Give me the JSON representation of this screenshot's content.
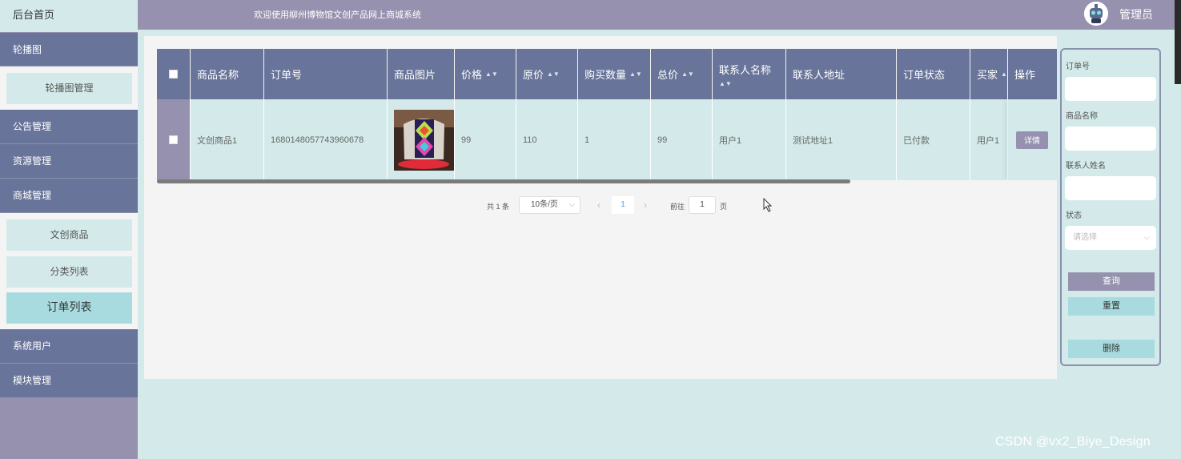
{
  "sidebar": {
    "home": "后台首页",
    "items": [
      "轮播图",
      "公告管理",
      "资源管理",
      "商城管理",
      "系统用户",
      "模块管理"
    ],
    "sub_carousel": [
      "轮播图管理"
    ],
    "sub_mall": [
      "文创商品",
      "分类列表",
      "订单列表"
    ],
    "active": "订单列表"
  },
  "header": {
    "welcome": "欢迎使用柳州博物馆文创产品网上商城系统",
    "user": "管理员"
  },
  "table": {
    "columns": [
      "商品名称",
      "订单号",
      "商品图片",
      "价格",
      "原价",
      "购买数量",
      "总价",
      "联系人名称",
      "联系人地址",
      "订单状态",
      "买家",
      "操作"
    ],
    "rows": [
      {
        "name": "文创商品1",
        "order_no": "1680148057743960678",
        "price": "99",
        "orig_price": "110",
        "qty": "1",
        "total": "99",
        "contact": "用户1",
        "address": "测试地址1",
        "status": "已付款",
        "buyer": "用户1",
        "action": "详情"
      }
    ]
  },
  "pagination": {
    "total": "共 1 条",
    "page_size": "10条/页",
    "current": "1",
    "goto_label": "前往",
    "goto_value": "1",
    "page_unit": "页"
  },
  "search": {
    "order_no_label": "订单号",
    "product_label": "商品名称",
    "contact_label": "联系人姓名",
    "status_label": "状态",
    "status_placeholder": "请选择",
    "query": "查询",
    "reset": "重置",
    "delete": "删除"
  },
  "watermark": "CSDN @vx2_Biye_Design",
  "colors": {
    "sidebar": "#687499",
    "header": "#9591ae",
    "panel_bg": "#d4eaea",
    "active_sub": "#a8dbdf"
  }
}
